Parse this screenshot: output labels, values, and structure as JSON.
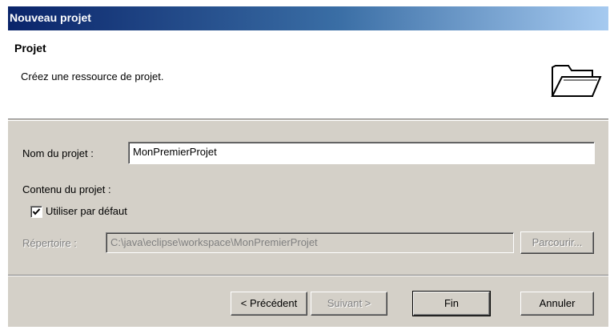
{
  "window": {
    "title": "Nouveau projet"
  },
  "banner": {
    "title": "Projet",
    "description": "Créez une ressource de projet.",
    "icon": "folder-icon"
  },
  "form": {
    "project_name_label": "Nom du projet :",
    "project_name_value": "MonPremierProjet",
    "contents_label": "Contenu du projet :",
    "use_default_label": "Utiliser par défaut",
    "use_default_checked": true,
    "directory_label": "Répertoire :",
    "directory_value": "C:\\java\\eclipse\\workspace\\MonPremierProjet",
    "browse_label": "Parcourir..."
  },
  "buttons": {
    "back": "< Précédent",
    "next": "Suivant >",
    "finish": "Fin",
    "cancel": "Annuler"
  }
}
